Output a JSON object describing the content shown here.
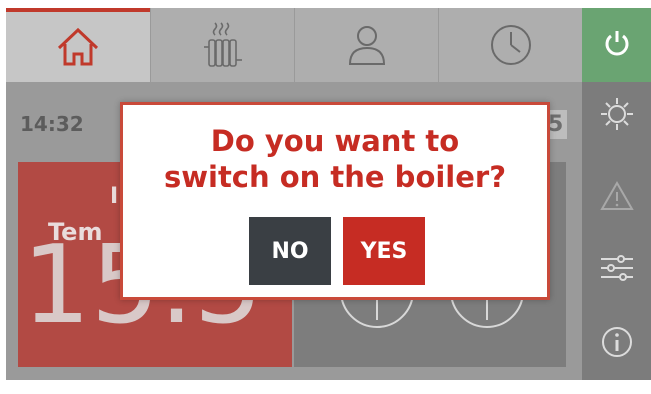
{
  "tabs": [
    {
      "name": "home",
      "icon": "home-icon",
      "active": true
    },
    {
      "name": "heating",
      "icon": "radiator-icon",
      "active": false
    },
    {
      "name": "user",
      "icon": "user-icon",
      "active": false
    },
    {
      "name": "schedule",
      "icon": "clock-icon",
      "active": false
    }
  ],
  "sidebar": {
    "items": [
      {
        "icon": "power-icon"
      },
      {
        "icon": "sun-snowflake-icon"
      },
      {
        "icon": "warning-icon"
      },
      {
        "icon": "sliders-icon"
      },
      {
        "icon": "info-icon"
      }
    ]
  },
  "status": {
    "time": "14:32",
    "right_fragment": "5"
  },
  "temperature": {
    "label_top": "I",
    "label": "Tem",
    "value": "15.5"
  },
  "dialog": {
    "message_line1": "Do you want to",
    "message_line2": "switch on the boiler?",
    "no_label": "NO",
    "yes_label": "YES"
  },
  "colors": {
    "accent_red": "#c62c23",
    "power_green": "#6aa472",
    "no_button": "#3a3f44"
  }
}
